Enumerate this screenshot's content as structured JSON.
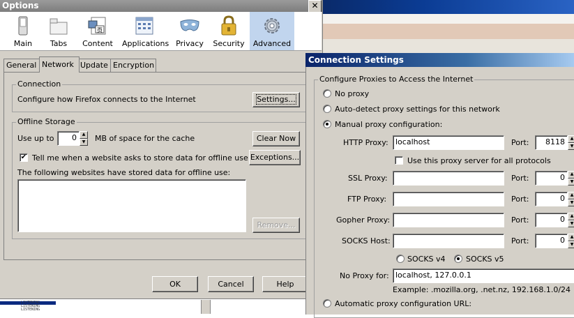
{
  "options": {
    "title": "Options",
    "close_glyph": "✕",
    "toolbar": [
      {
        "label": "Main",
        "icon": "main-switch-icon"
      },
      {
        "label": "Tabs",
        "icon": "tabs-icon"
      },
      {
        "label": "Content",
        "icon": "content-icon"
      },
      {
        "label": "Applications",
        "icon": "applications-icon"
      },
      {
        "label": "Privacy",
        "icon": "privacy-mask-icon"
      },
      {
        "label": "Security",
        "icon": "security-lock-icon"
      },
      {
        "label": "Advanced",
        "icon": "advanced-gear-icon"
      }
    ],
    "tabs": [
      "General",
      "Network",
      "Update",
      "Encryption"
    ],
    "active_tab": "Network",
    "connection": {
      "title": "Connection",
      "description": "Configure how Firefox connects to the Internet",
      "settings_button": "Settings..."
    },
    "offline_storage": {
      "title": "Offline Storage",
      "use_up_to": "Use up to",
      "cache_value": "0",
      "cache_suffix": "MB of space for the cache",
      "clear_now": "Clear Now",
      "tell_me": "Tell me when a website asks to store data for offline use",
      "tell_me_checked": "✔",
      "exceptions": "Exceptions...",
      "stored_label": "The following websites have stored data for offline use:",
      "remove": "Remove..."
    },
    "buttons": {
      "ok": "OK",
      "cancel": "Cancel",
      "help": "Help"
    }
  },
  "background": {
    "status_lines": [
      "LISTENING",
      "LISTENING",
      "LISTENING"
    ]
  },
  "connection_settings": {
    "title": "Connection Settings",
    "group_title": "Configure Proxies to Access the Internet",
    "no_proxy": "No proxy",
    "auto_detect": "Auto-detect proxy settings for this network",
    "manual": "Manual proxy configuration:",
    "http_label": "HTTP Proxy:",
    "http_value": "localhost",
    "port_label": "Port:",
    "http_port": "8118",
    "same_proxy": "Use this proxy server for all protocols",
    "ssl_label": "SSL Proxy:",
    "ssl_value": "",
    "ssl_port": "0",
    "ftp_label": "FTP Proxy:",
    "ftp_value": "",
    "ftp_port": "0",
    "gopher_label": "Gopher Proxy:",
    "gopher_value": "",
    "gopher_port": "0",
    "socks_label": "SOCKS Host:",
    "socks_value": "",
    "socks_port": "0",
    "socks_v4": "SOCKS v4",
    "socks_v5": "SOCKS v5",
    "no_proxy_for_label": "No Proxy for:",
    "no_proxy_for_value": "localhost, 127.0.0.1",
    "example": "Example: .mozilla.org, .net.nz, 192.168.1.0/24",
    "auto_url": "Automatic proxy configuration URL:",
    "selected_mode": "manual",
    "selected_socks": "v5"
  }
}
